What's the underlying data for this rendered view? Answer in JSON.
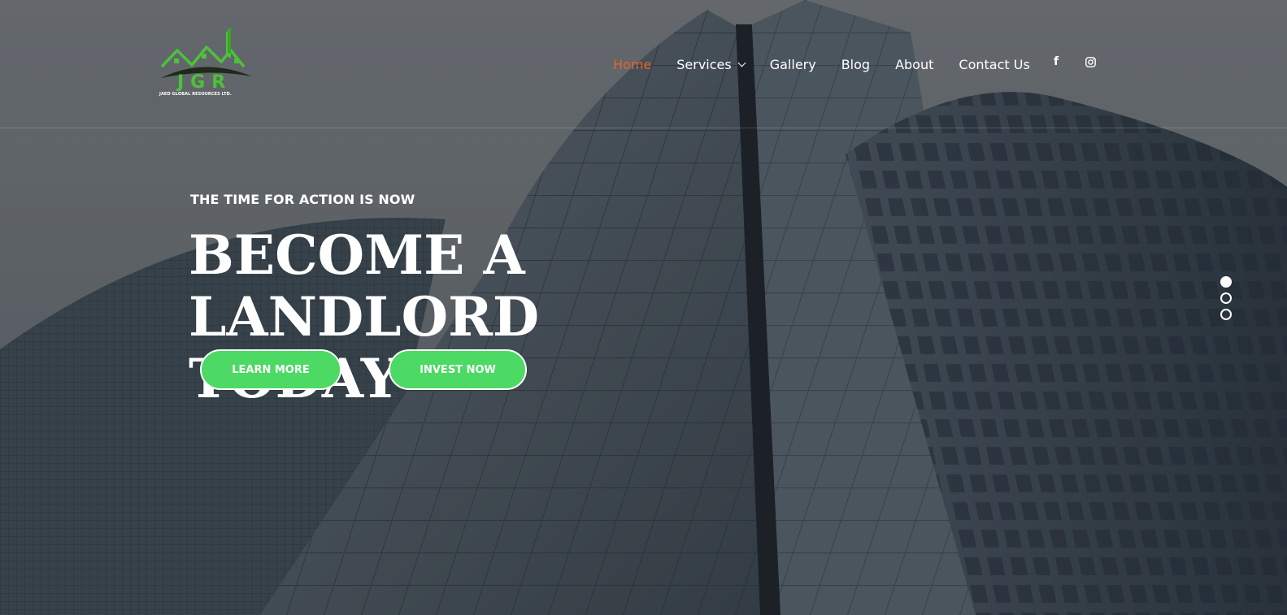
{
  "logo": {
    "letters": "JGR",
    "tagline": "JAED GLOBAL RESOURCES LTD.",
    "accent_color": "#4cc23a"
  },
  "nav": {
    "items": [
      {
        "label": "Home",
        "active": true
      },
      {
        "label": "Services",
        "has_dropdown": true
      },
      {
        "label": "Gallery"
      },
      {
        "label": "Blog"
      },
      {
        "label": "About"
      },
      {
        "label": "Contact Us"
      }
    ],
    "active_color": "#e0672c",
    "social": [
      {
        "icon": "facebook-icon",
        "glyph": "f"
      },
      {
        "icon": "instagram-icon"
      }
    ]
  },
  "hero": {
    "eyebrow": "THE TIME FOR ACTION IS NOW",
    "headline_line1": "BECOME A LANDLORD",
    "headline_line2": "TODAY",
    "buttons": {
      "learn_more": "LEARN MORE",
      "invest_now": "INVEST NOW"
    },
    "button_color": "#4cd964"
  },
  "slider": {
    "count": 3,
    "active_index": 0
  }
}
